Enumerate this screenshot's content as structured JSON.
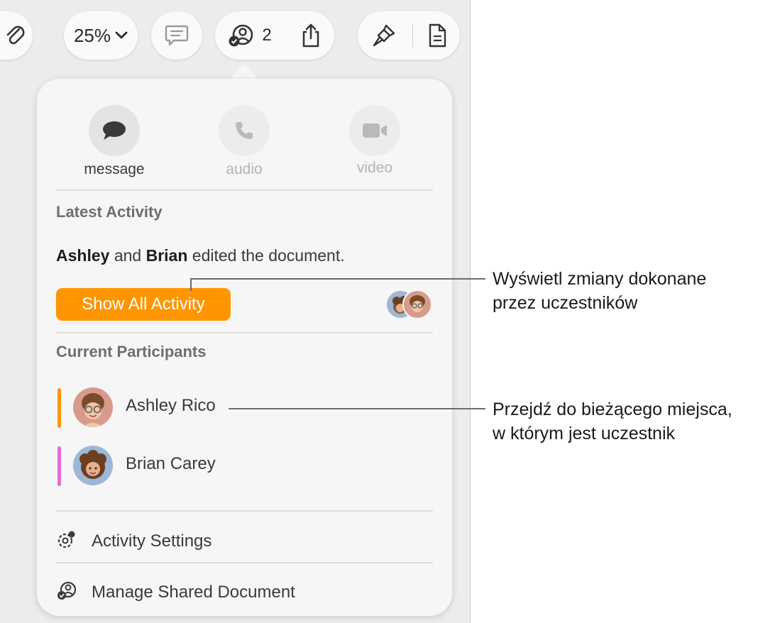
{
  "toolbar": {
    "zoom_value": "25%",
    "collaborator_count": "2"
  },
  "popover": {
    "communication": {
      "message_label": "message",
      "audio_label": "audio",
      "video_label": "video"
    },
    "latest_activity": {
      "title": "Latest Activity",
      "user1": "Ashley",
      "conjunction": " and ",
      "user2": "Brian",
      "action": " edited the document.",
      "show_button_label": "Show All Activity"
    },
    "current_participants": {
      "title": "Current Participants",
      "items": [
        {
          "name": "Ashley Rico",
          "color": "#ff9500"
        },
        {
          "name": "Brian Carey",
          "color": "#e86ad8"
        }
      ]
    },
    "menu": {
      "activity_settings": "Activity Settings",
      "manage_shared": "Manage Shared Document"
    }
  },
  "callouts": {
    "first_line1": "Wyświetl zmiany dokonane",
    "first_line2": "przez uczestników",
    "second_line1": "Przejdź do bieżącego miejsca,",
    "second_line2": "w którym jest uczestnik"
  },
  "colors": {
    "accent": "#ff9500",
    "participant_ashley": "#ff9500",
    "participant_brian": "#e86ad8"
  }
}
